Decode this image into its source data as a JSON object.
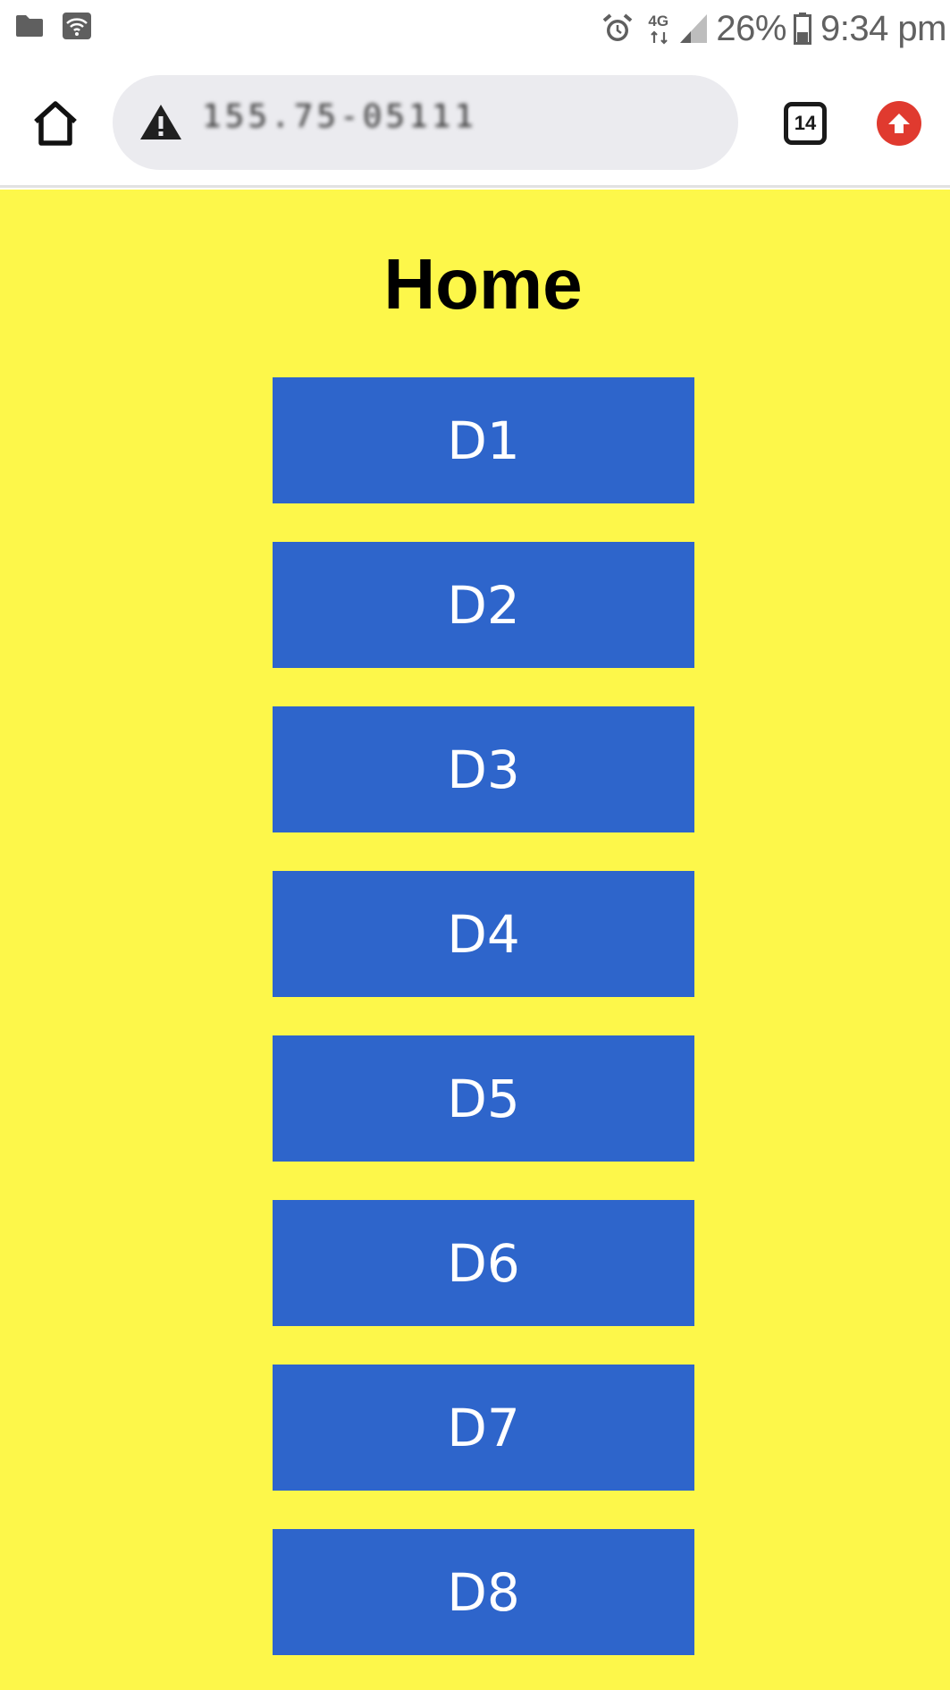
{
  "status_bar": {
    "icons_left": [
      "folder-icon",
      "wifi-icon"
    ],
    "icons_right": [
      "alarm-icon",
      "network-4g-icon",
      "signal-icon",
      "battery-icon"
    ],
    "network_label": "4G",
    "battery_percent": "26%",
    "time": "9:34 pm"
  },
  "browser": {
    "url_text": "155.75-05111",
    "tab_count": "14",
    "icons": [
      "home-icon",
      "warning-icon",
      "tab-switcher-icon",
      "update-icon"
    ]
  },
  "page": {
    "title": "Home",
    "background_color": "#fdf74a",
    "button_color": "#2e65cb",
    "buttons": [
      {
        "label": "D1"
      },
      {
        "label": "D2"
      },
      {
        "label": "D3"
      },
      {
        "label": "D4"
      },
      {
        "label": "D5"
      },
      {
        "label": "D6"
      },
      {
        "label": "D7"
      },
      {
        "label": "D8"
      }
    ]
  }
}
